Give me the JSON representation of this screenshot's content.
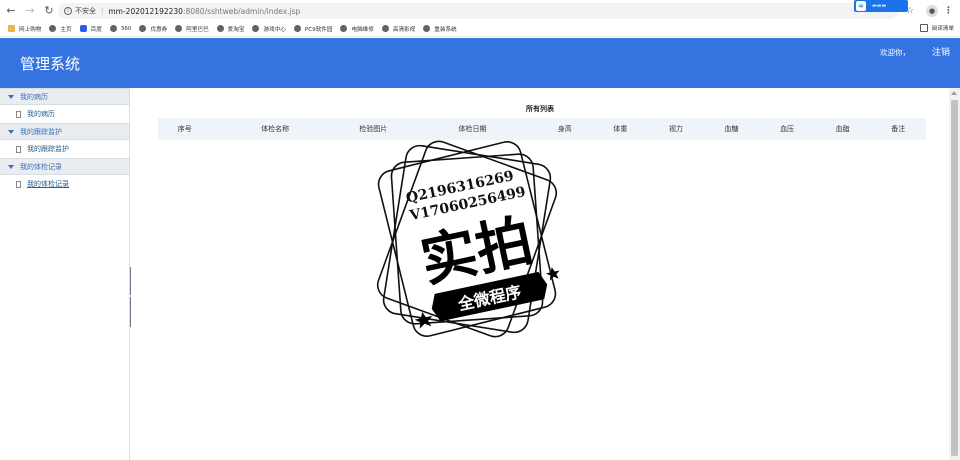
{
  "browser": {
    "insecure_label": "不安全",
    "url_host": "mm-202012192230",
    "url_path": ":8080/sshtweb/admin/index.jsp",
    "reading_list": "阅读清单",
    "bookmarks": [
      "网上购物",
      "主页",
      "百度",
      "360",
      "优惠券",
      "阿里巴巴",
      "爱淘宝",
      "游戏中心",
      "PC9软件园",
      "电脑维修",
      "高清影视",
      "重装系统"
    ]
  },
  "header": {
    "title": "管理系统",
    "welcome": "欢迎你，",
    "logout": "注销"
  },
  "sidebar": {
    "groups": [
      {
        "title": "我的病历",
        "item": "我的病历"
      },
      {
        "title": "我的跟踪监护",
        "item": "我的跟踪监护"
      },
      {
        "title": "我的体检记录",
        "item": "我的体检记录"
      }
    ]
  },
  "main": {
    "list_title": "所有列表",
    "columns": [
      "序号",
      "体检名称",
      "检验图片",
      "体检日期",
      "身高",
      "体重",
      "视力",
      "血糖",
      "血压",
      "血脂",
      "备注"
    ],
    "rows": []
  },
  "watermark": {
    "line1": "Q2196316269",
    "line2": "V17060256499",
    "big": "实拍",
    "banner": "全微程序"
  },
  "colors": {
    "header_bg": "#3574e0",
    "sidebar_group_bg": "#e9edf2",
    "table_head_bg": "#eef4fa"
  }
}
